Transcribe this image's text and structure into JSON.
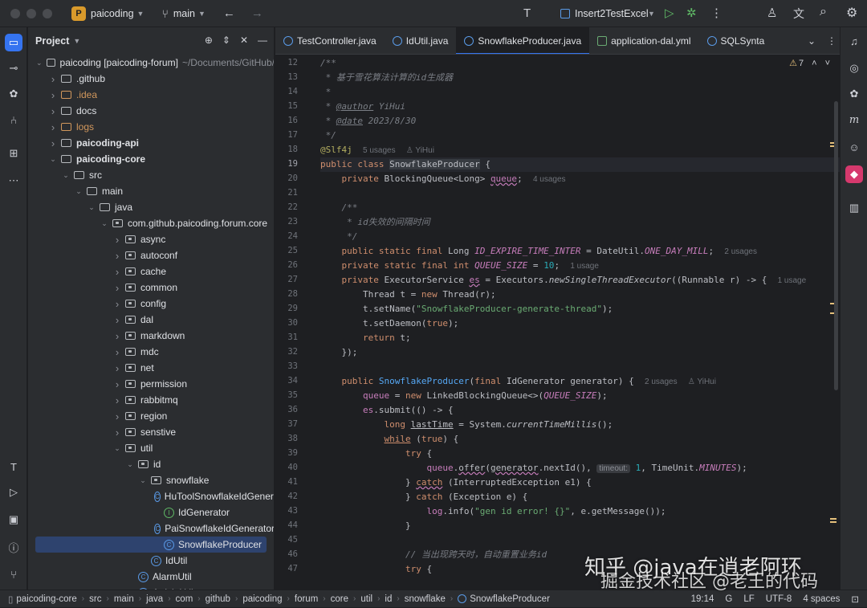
{
  "titlebar": {
    "project_badge": "P",
    "project_name": "paicoding",
    "branch": "main",
    "run_config": "Insert2TestExcel"
  },
  "project_panel": {
    "title": "Project",
    "tree": [
      {
        "label": "paicoding [paicoding-forum]",
        "suffix": "~/Documents/GitHub/",
        "depth": 0,
        "kind": "module",
        "open": true,
        "bold": false
      },
      {
        "label": ".github",
        "depth": 1,
        "kind": "folder",
        "open": false
      },
      {
        "label": ".idea",
        "depth": 1,
        "kind": "folder-orange",
        "open": false
      },
      {
        "label": "docs",
        "depth": 1,
        "kind": "folder",
        "open": false
      },
      {
        "label": "logs",
        "depth": 1,
        "kind": "folder-orange",
        "open": false
      },
      {
        "label": "paicoding-api",
        "depth": 1,
        "kind": "folder",
        "open": false,
        "bold": true
      },
      {
        "label": "paicoding-core",
        "depth": 1,
        "kind": "folder",
        "open": true,
        "bold": true
      },
      {
        "label": "src",
        "depth": 2,
        "kind": "folder",
        "open": true
      },
      {
        "label": "main",
        "depth": 3,
        "kind": "folder",
        "open": true
      },
      {
        "label": "java",
        "depth": 4,
        "kind": "folder",
        "open": true
      },
      {
        "label": "com.github.paicoding.forum.core",
        "depth": 5,
        "kind": "package",
        "open": true
      },
      {
        "label": "async",
        "depth": 6,
        "kind": "package",
        "open": false
      },
      {
        "label": "autoconf",
        "depth": 6,
        "kind": "package",
        "open": false
      },
      {
        "label": "cache",
        "depth": 6,
        "kind": "package",
        "open": false
      },
      {
        "label": "common",
        "depth": 6,
        "kind": "package",
        "open": false
      },
      {
        "label": "config",
        "depth": 6,
        "kind": "package",
        "open": false
      },
      {
        "label": "dal",
        "depth": 6,
        "kind": "package",
        "open": false
      },
      {
        "label": "markdown",
        "depth": 6,
        "kind": "package",
        "open": false
      },
      {
        "label": "mdc",
        "depth": 6,
        "kind": "package",
        "open": false
      },
      {
        "label": "net",
        "depth": 6,
        "kind": "package",
        "open": false
      },
      {
        "label": "permission",
        "depth": 6,
        "kind": "package",
        "open": false
      },
      {
        "label": "rabbitmq",
        "depth": 6,
        "kind": "package",
        "open": false
      },
      {
        "label": "region",
        "depth": 6,
        "kind": "package",
        "open": false
      },
      {
        "label": "senstive",
        "depth": 6,
        "kind": "package",
        "open": false
      },
      {
        "label": "util",
        "depth": 6,
        "kind": "package",
        "open": true
      },
      {
        "label": "id",
        "depth": 7,
        "kind": "package",
        "open": true
      },
      {
        "label": "snowflake",
        "depth": 8,
        "kind": "package",
        "open": true
      },
      {
        "label": "HuToolSnowflakeIdGenerator",
        "depth": 9,
        "kind": "class"
      },
      {
        "label": "IdGenerator",
        "depth": 9,
        "kind": "interface"
      },
      {
        "label": "PaiSnowflakeIdGenerator",
        "depth": 9,
        "kind": "class"
      },
      {
        "label": "SnowflakeProducer",
        "depth": 9,
        "kind": "class",
        "selected": true
      },
      {
        "label": "IdUtil",
        "depth": 8,
        "kind": "class"
      },
      {
        "label": "AlarmUtil",
        "depth": 7,
        "kind": "class"
      },
      {
        "label": "ArticleUtil",
        "depth": 7,
        "kind": "class"
      }
    ]
  },
  "editor": {
    "tabs": [
      {
        "label": "TestController.java",
        "kind": "class",
        "active": false
      },
      {
        "label": "IdUtil.java",
        "kind": "class",
        "active": false
      },
      {
        "label": "SnowflakeProducer.java",
        "kind": "class",
        "active": true
      },
      {
        "label": "application-dal.yml",
        "kind": "yml",
        "active": false
      },
      {
        "label": "SQLSynta",
        "kind": "class",
        "active": false
      }
    ],
    "warnings_count": "7",
    "line_numbers": [
      "12",
      "13",
      "14",
      "15",
      "16",
      "17",
      "18",
      "19",
      "20",
      "21",
      "22",
      "23",
      "24",
      "25",
      "26",
      "27",
      "28",
      "29",
      "30",
      "31",
      "32",
      "33",
      "34",
      "35",
      "36",
      "37",
      "38",
      "39",
      "40",
      "41",
      "42",
      "43",
      "44",
      "45",
      "46",
      "47"
    ],
    "hints": {
      "usages5": "5 usages",
      "usages4": "4 usages",
      "usages2": "2 usages",
      "usage1": "1 usage",
      "author": "YiHui",
      "timeout": "timeout:"
    }
  },
  "statusbar": {
    "breadcrumbs": [
      "paicoding-core",
      "src",
      "main",
      "java",
      "com",
      "github",
      "paicoding",
      "forum",
      "core",
      "util",
      "id",
      "snowflake",
      "SnowflakeProducer"
    ],
    "position": "19:14",
    "line_ending": "LF",
    "encoding": "UTF-8",
    "indent": "4 spaces"
  },
  "watermark": {
    "line1": "知乎 @java在逍老阿环",
    "line2": "掘金技术社区 @老王的代码"
  },
  "colors": {
    "accent": "#3574f0",
    "background": "#1e1f22",
    "panel": "#2b2d30",
    "keyword": "#cf8e6d",
    "string": "#6aab73",
    "field": "#c77dbb",
    "comment": "#7a7e85",
    "annotation": "#b3ae60"
  }
}
